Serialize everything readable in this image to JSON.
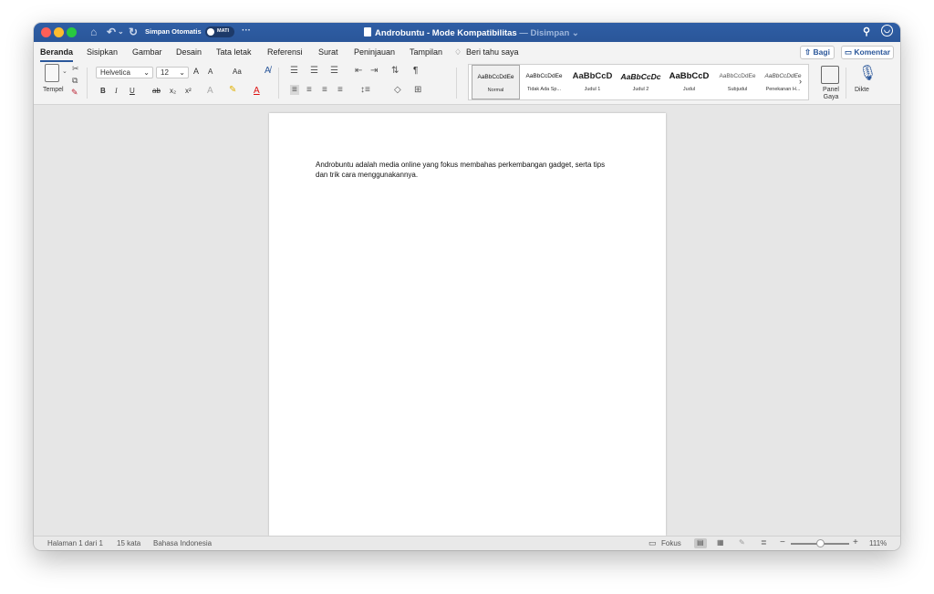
{
  "titlebar": {
    "autosave_label": "Simpan Otomatis",
    "autosave_state": "MATI",
    "more": "···",
    "doc_name": "Androbuntu",
    "doc_mode": "Mode Kompatibilitas",
    "doc_status": "— Disimpan",
    "bg_color": "#2b5797"
  },
  "tabs": [
    {
      "label": "Beranda",
      "active": true
    },
    {
      "label": "Sisipkan"
    },
    {
      "label": "Gambar"
    },
    {
      "label": "Desain"
    },
    {
      "label": "Tata letak"
    },
    {
      "label": "Referensi"
    },
    {
      "label": "Surat"
    },
    {
      "label": "Peninjauan"
    },
    {
      "label": "Tampilan"
    },
    {
      "label": "Beri tahu saya"
    }
  ],
  "share": {
    "bagi": "Bagi",
    "komentar": "Komentar"
  },
  "ribbon": {
    "paste_label": "Tempel",
    "font_name": "Helvetica",
    "font_size": "12",
    "bold": "B",
    "italic": "I",
    "underline": "U",
    "strike": "ab",
    "subscript": "x₂",
    "superscript": "x²",
    "grow": "A",
    "shrink": "A",
    "case": "Aa",
    "pilcrow": "¶",
    "styles": [
      {
        "preview": "AaBbCcDdEe",
        "name": "Normal",
        "selected": true
      },
      {
        "preview": "AaBbCcDdEe",
        "name": "Tidak Ada Sp..."
      },
      {
        "preview": "AaBbCcD",
        "name": "Judul 1"
      },
      {
        "preview": "AaBbCcDc",
        "name": "Judul 2"
      },
      {
        "preview": "AaBbCcD",
        "name": "Judul"
      },
      {
        "preview": "AaBbCcDdEe",
        "name": "Subjudul"
      },
      {
        "preview": "AaBbCcDdEe",
        "name": "Penekanan H..."
      }
    ],
    "style_pane": "Panel Gaya",
    "dictate": "Dikte"
  },
  "document": {
    "text": "Androbuntu adalah media online yang fokus membahas perkembangan gadget, serta tips dan trik cara menggunakannya."
  },
  "status": {
    "page": "Halaman 1 dari 1",
    "words": "15 kata",
    "language": "Bahasa Indonesia",
    "focus": "Fokus",
    "zoom": "111%"
  }
}
